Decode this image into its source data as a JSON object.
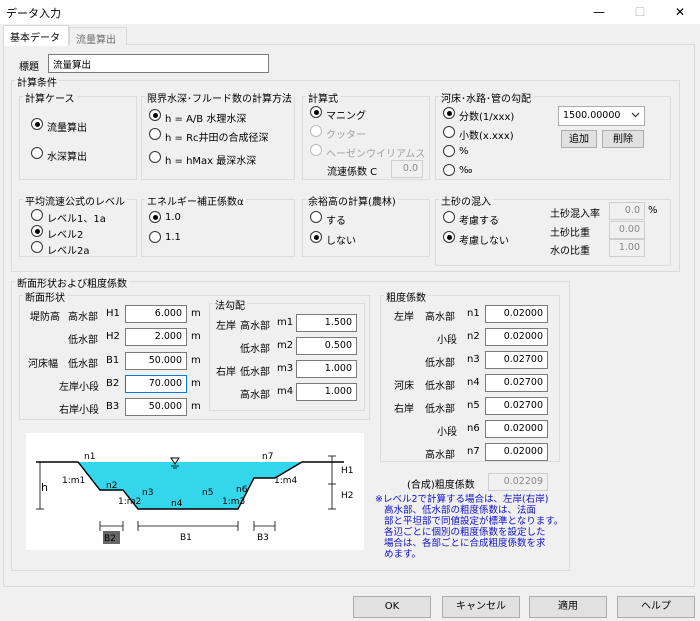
{
  "window": {
    "title": "データ入力",
    "minimize": "—",
    "maximize": "☐",
    "close": "✕"
  },
  "tabs": [
    "基本データ",
    "流量算出"
  ],
  "title_field": {
    "label": "標題",
    "value": "流量算出"
  },
  "calc_conditions": {
    "label": "計算条件",
    "case": {
      "title": "計算ケース",
      "options": [
        "流量算出",
        "水深算出"
      ],
      "selected": 0
    },
    "method": {
      "title": "限界水深･フルード数の計算方法",
      "options": [
        "h = A/B 水理水深",
        "h = Rc井田の合成径深",
        "h = hMax 最深水深"
      ],
      "selected": 0
    },
    "formula": {
      "title": "計算式",
      "options": [
        "マニング",
        "クッター",
        "ヘーゼンウイリアムス"
      ],
      "selected": 0,
      "coef_label": "流速係数 C",
      "coef_value": "0.0"
    },
    "slope": {
      "title": "河床･水路･管の勾配",
      "options": [
        "分数(1/xxx)",
        "小数(x.xxx)",
        "%",
        "‰"
      ],
      "selected": 0,
      "combo_value": "1500.00000",
      "add_label": "追加",
      "delete_label": "削除"
    },
    "level": {
      "title": "平均流速公式のレベル",
      "options": [
        "レベル1、1a",
        "レベル2",
        "レベル2a"
      ],
      "selected": 1
    },
    "energy": {
      "title": "エネルギー補正係数α",
      "options": [
        "1.0",
        "1.1"
      ],
      "selected": 0
    },
    "freeboard": {
      "title": "余裕高の計算(農林)",
      "options": [
        "する",
        "しない"
      ],
      "selected": 1
    },
    "sediment": {
      "title": "土砂の混入",
      "options": [
        "考慮する",
        "考慮しない"
      ],
      "selected": 1,
      "fields": [
        {
          "label": "土砂混入率",
          "value": "0.0",
          "unit": "%"
        },
        {
          "label": "土砂比重",
          "value": "0.00",
          "unit": ""
        },
        {
          "label": "水の比重",
          "value": "1.00",
          "unit": ""
        }
      ]
    }
  },
  "section": {
    "label": "断面形状および粗度係数",
    "shape_title": "断面形状",
    "shape_rows": [
      {
        "label_a": "堤防高",
        "label_b": "高水部",
        "key": "H1",
        "value": "6.000",
        "unit": "m"
      },
      {
        "label_a": "",
        "label_b": "低水部",
        "key": "H2",
        "value": "2.000",
        "unit": "m"
      },
      {
        "label_a": "河床幅",
        "label_b": "低水部",
        "key": "B1",
        "value": "50.000",
        "unit": "m"
      },
      {
        "label_a": "",
        "label_b": "左岸小段",
        "key": "B2",
        "value": "70.000",
        "unit": "m"
      },
      {
        "label_a": "",
        "label_b": "右岸小段",
        "key": "B3",
        "value": "50.000",
        "unit": "m"
      }
    ],
    "slope_title": "法勾配",
    "slope_rows": [
      {
        "side": "左岸",
        "part": "高水部",
        "key": "m1",
        "value": "1.500"
      },
      {
        "side": "",
        "part": "低水部",
        "key": "m2",
        "value": "0.500"
      },
      {
        "side": "右岸",
        "part": "低水部",
        "key": "m3",
        "value": "1.000"
      },
      {
        "side": "",
        "part": "高水部",
        "key": "m4",
        "value": "1.000"
      }
    ],
    "roughness_title": "粗度係数",
    "roughness_rows": [
      {
        "side": "左岸",
        "part": "高水部",
        "key": "n1",
        "value": "0.02000"
      },
      {
        "side": "",
        "part": "小段",
        "key": "n2",
        "value": "0.02000"
      },
      {
        "side": "",
        "part": "低水部",
        "key": "n3",
        "value": "0.02700"
      },
      {
        "side": "河床",
        "part": "低水部",
        "key": "n4",
        "value": "0.02700"
      },
      {
        "side": "右岸",
        "part": "低水部",
        "key": "n5",
        "value": "0.02700"
      },
      {
        "side": "",
        "part": "小段",
        "key": "n6",
        "value": "0.02000"
      },
      {
        "side": "",
        "part": "高水部",
        "key": "n7",
        "value": "0.02000"
      }
    ],
    "composite_label": "(合成)粗度係数",
    "composite_value": "0.02209",
    "note": [
      "※レベル2で計算する場合は、左岸(右岸)",
      "高水部、低水部の粗度係数は、法面",
      "部と平坦部で同値設定が標準となります。",
      "各辺ごとに個別の粗度係数を設定した",
      "場合は、各部ごとに合成粗度係数を求",
      "めます。"
    ]
  },
  "diagram": {
    "labels": {
      "n1": "n1",
      "n2": "n2",
      "n3": "n3",
      "n4": "n4",
      "n5": "n5",
      "n6": "n6",
      "n7": "n7",
      "m1": "1:m1",
      "m2": "1:m2",
      "m3": "1:m3",
      "m4": "1:m4",
      "h": "h",
      "H1": "H1",
      "H2": "H2",
      "B1": "B1",
      "B2": "B2",
      "B3": "B3"
    },
    "water_color": "#33d6ea"
  },
  "buttons": {
    "ok": "OK",
    "cancel": "キャンセル",
    "apply": "適用",
    "help": "ヘルプ"
  }
}
